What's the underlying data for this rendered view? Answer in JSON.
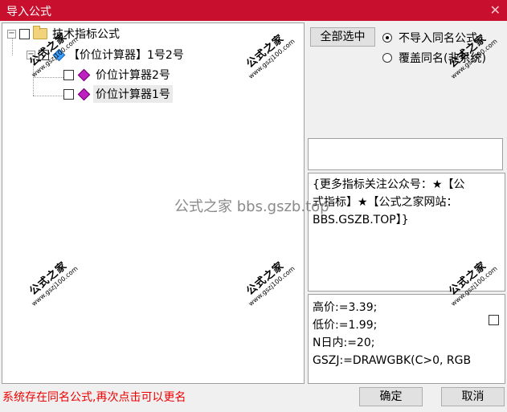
{
  "window": {
    "title": "导入公式",
    "close_glyph": "✕"
  },
  "tree": {
    "root_label": "技术指标公式",
    "group_label": "【价位计算器】1号2号",
    "items": [
      {
        "label": "价位计算器2号",
        "selected": false
      },
      {
        "label": "价位计算器1号",
        "selected": true
      }
    ]
  },
  "controls": {
    "select_all": "全部选中",
    "radio_skip": "不导入同名公式",
    "radio_overwrite": "覆盖同名(非系统)",
    "radio_selected": "skip"
  },
  "description": {
    "line1": "{更多指标关注公众号：★【公",
    "line2": "式指标】★【公式之家网站：",
    "line3": "BBS.GSZB.TOP】}"
  },
  "code": {
    "line1": "高价:=3.39;",
    "line2": "低价:=1.99;",
    "line3": "N日内:=20;",
    "line4": "GSZJ:=DRAWGBK(C>0, RGB"
  },
  "footer": {
    "status": "系统存在同名公式,再次点击可以更名",
    "ok": "确定",
    "cancel": "取消"
  },
  "watermark": {
    "center": "公式之家 bbs.gszb.top",
    "big": "公式之家",
    "small": "www.gszj100.com"
  },
  "colors": {
    "titlebar": "#c8102e",
    "status_text": "#e00000"
  }
}
